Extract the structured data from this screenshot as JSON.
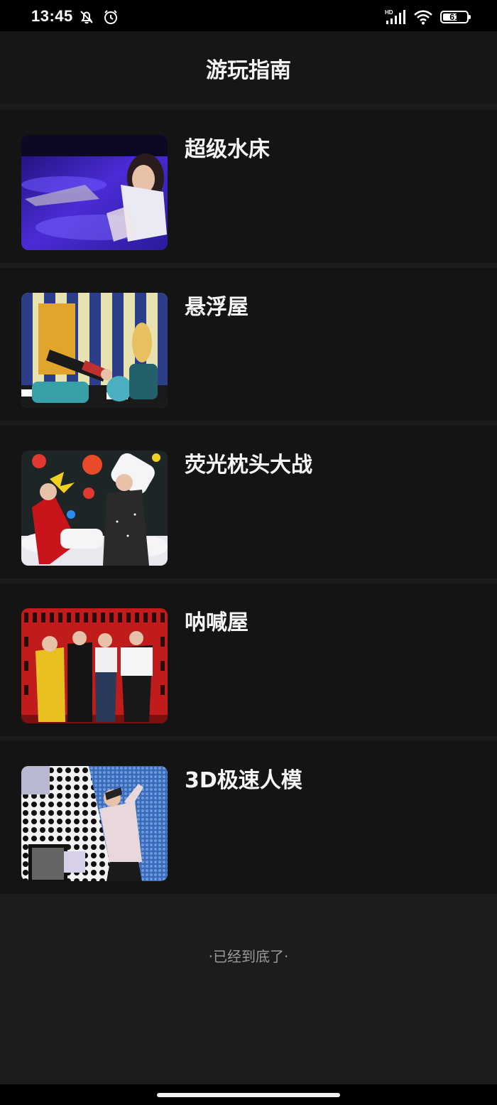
{
  "status_bar": {
    "time": "13:45",
    "network_label": "HD",
    "battery_level": "61",
    "battery_percent": 61
  },
  "nav": {
    "title": "游玩指南"
  },
  "items": [
    {
      "title": "超级水床"
    },
    {
      "title": "悬浮屋"
    },
    {
      "title": "荧光枕头大战"
    },
    {
      "title": "呐喊屋"
    },
    {
      "title": "3D极速人模"
    }
  ],
  "footer": {
    "end_text": "·已经到底了·"
  },
  "colors": {
    "background": "#1c1c1c",
    "card": "#141415",
    "text": "#f5f5f5",
    "muted": "#9a9a9a"
  }
}
